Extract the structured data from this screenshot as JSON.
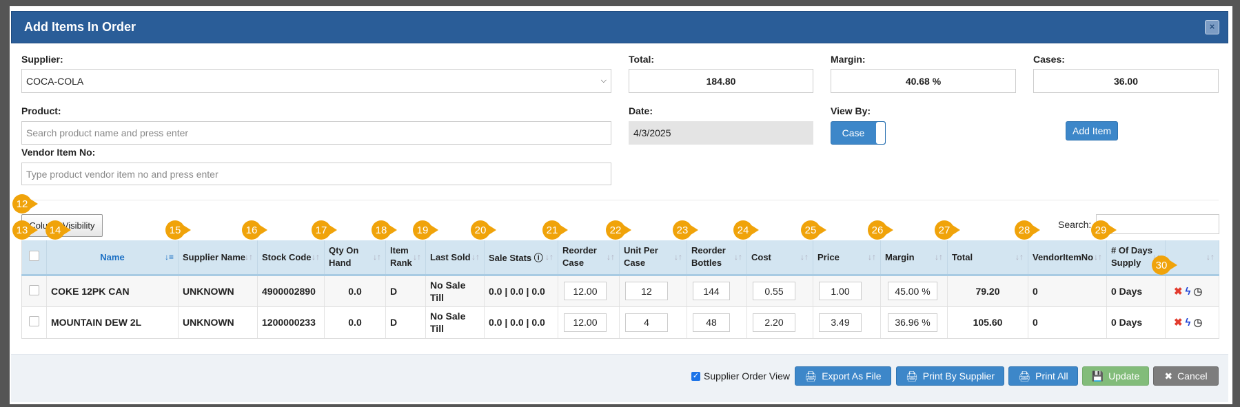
{
  "modal": {
    "title": "Add Items In Order",
    "close_label": "×"
  },
  "form": {
    "supplier_label": "Supplier:",
    "supplier_value": "COCA-COLA",
    "product_label": "Product:",
    "product_placeholder": "Search product name and press enter",
    "vendor_label": "Vendor Item No:",
    "vendor_placeholder": "Type product vendor item no and press enter",
    "total_label": "Total:",
    "total_value": "184.80",
    "margin_label": "Margin:",
    "margin_value": "40.68 %",
    "cases_label": "Cases:",
    "cases_value": "36.00",
    "date_label": "Date:",
    "date_value": "4/3/2025",
    "viewby_label": "View By:",
    "viewby_value": "Case",
    "add_item": "Add Item"
  },
  "table": {
    "column_visibility": "Column Visibility",
    "search_label": "Search:",
    "columns": [
      "",
      "Name",
      "Supplier Name",
      "Stock Code",
      "Qty On Hand",
      "Item Rank",
      "Last Sold",
      "Sale Stats",
      "Reorder Case",
      "Unit Per Case",
      "Reorder Bottles",
      "Cost",
      "Price",
      "Margin",
      "Total",
      "VendorItemNo",
      "# Of Days Supply",
      ""
    ],
    "rows": [
      {
        "name": "COKE 12PK CAN",
        "supplier": "UNKNOWN",
        "stock": "4900002890",
        "qty": "0.0",
        "rank": "D",
        "last_sold": "No Sale Till",
        "stats": "0.0 | 0.0 | 0.0",
        "reorder_case": "12.00",
        "unit_per_case": "12",
        "reorder_bottles": "144",
        "cost": "0.55",
        "price": "1.00",
        "margin": "45.00 %",
        "total": "79.20",
        "vendor_no": "0",
        "days": "0 Days"
      },
      {
        "name": "MOUNTAIN DEW 2L",
        "supplier": "UNKNOWN",
        "stock": "1200000233",
        "qty": "0.0",
        "rank": "D",
        "last_sold": "No Sale Till",
        "stats": "0.0 | 0.0 | 0.0",
        "reorder_case": "12.00",
        "unit_per_case": "4",
        "reorder_bottles": "48",
        "cost": "2.20",
        "price": "3.49",
        "margin": "36.96 %",
        "total": "105.60",
        "vendor_no": "0",
        "days": "0 Days"
      }
    ]
  },
  "footer": {
    "supplier_order_view": "Supplier Order View",
    "supplier_order_view_checked": true,
    "export": "Export As File",
    "print_supplier": "Print By Supplier",
    "print_all": "Print All",
    "update": "Update",
    "cancel": "Cancel"
  },
  "annotations": [
    "12",
    "13",
    "14",
    "15",
    "16",
    "17",
    "18",
    "19",
    "20",
    "21",
    "22",
    "23",
    "24",
    "25",
    "26",
    "27",
    "28",
    "29",
    "30"
  ],
  "colors": {
    "header": "#2a5d98",
    "primary": "#3d87c9",
    "success": "#82bc7a",
    "muted": "#7d7d7d",
    "badge": "#f0a30a",
    "table_header": "#d3e5f1"
  }
}
